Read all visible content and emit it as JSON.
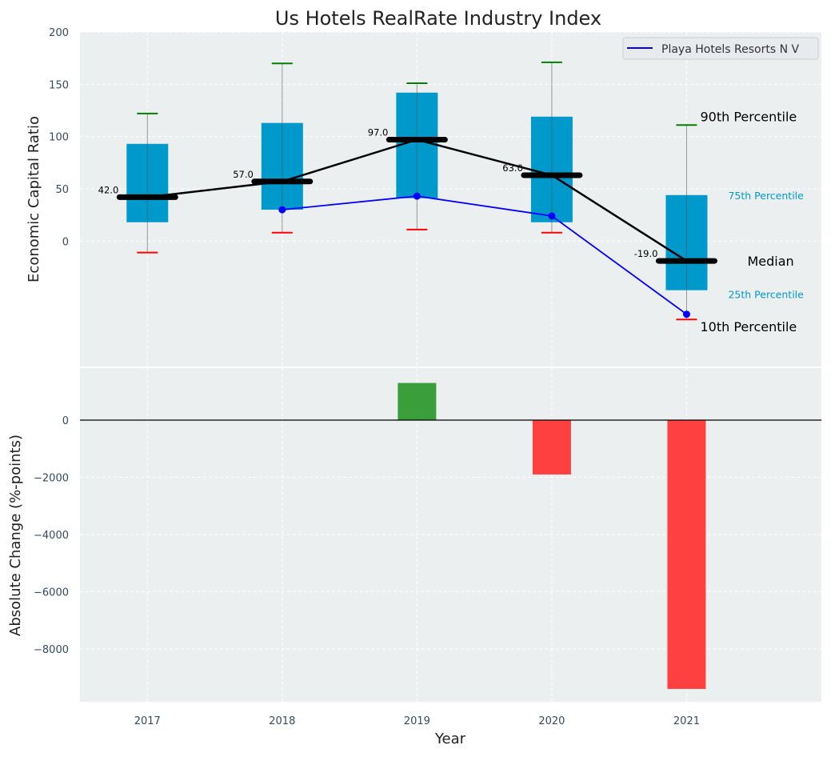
{
  "chart_data": [
    {
      "type": "box-range",
      "title": "Us Hotels RealRate Industry Index",
      "xlabel": "",
      "ylabel": "Economic Capital Ratio",
      "ylim": [
        -120,
        200
      ],
      "yticks": [
        0,
        50,
        100,
        150,
        200
      ],
      "xlim": [
        2016.5,
        2022
      ],
      "grid": true,
      "categories": [
        2017,
        2018,
        2019,
        2020,
        2021
      ],
      "p90": [
        122,
        170,
        151,
        171,
        111
      ],
      "p75": [
        93,
        113,
        142,
        119,
        44
      ],
      "median": [
        42,
        57,
        97,
        63,
        -19
      ],
      "p25": [
        18,
        30,
        41,
        18,
        -47
      ],
      "p10": [
        -11,
        8,
        11,
        8,
        -75
      ],
      "median_labels": [
        "42.0",
        "57.0",
        "97.0",
        "63.0",
        "-19.0"
      ],
      "series": [
        {
          "name": "Playa Hotels Resorts N V",
          "x": [
            2018,
            2019,
            2020,
            2021
          ],
          "values": [
            30,
            43,
            24,
            -70
          ],
          "color": "#0000ff"
        }
      ],
      "legend_position": "top-right",
      "annotations": {
        "p90": "90th Percentile",
        "p75": "75th Percentile",
        "median": "Median",
        "p25": "25th Percentile",
        "p10": "10th Percentile"
      },
      "colors": {
        "box": "#0099cc",
        "p90": "#008000",
        "p10": "#ff0000",
        "median": "#000000",
        "background": "#eceff0"
      }
    },
    {
      "type": "bar",
      "xlabel": "Year",
      "ylabel": "Absolute Change (%-points)",
      "ylim": [
        -9850,
        1820
      ],
      "yticks": [
        0,
        -2000,
        -4000,
        -6000,
        -8000
      ],
      "yticklabels": [
        "0",
        "−2000",
        "−4000",
        "−6000",
        "−8000"
      ],
      "categories": [
        2017,
        2018,
        2019,
        2020,
        2021
      ],
      "xticklabels": [
        "2017",
        "2018",
        "2019",
        "2020",
        "2021"
      ],
      "values": [
        null,
        null,
        1300,
        -1900,
        -9400
      ],
      "grid": true,
      "colors": {
        "positive": "#3a9e3a",
        "negative": "#ff4040"
      }
    }
  ]
}
